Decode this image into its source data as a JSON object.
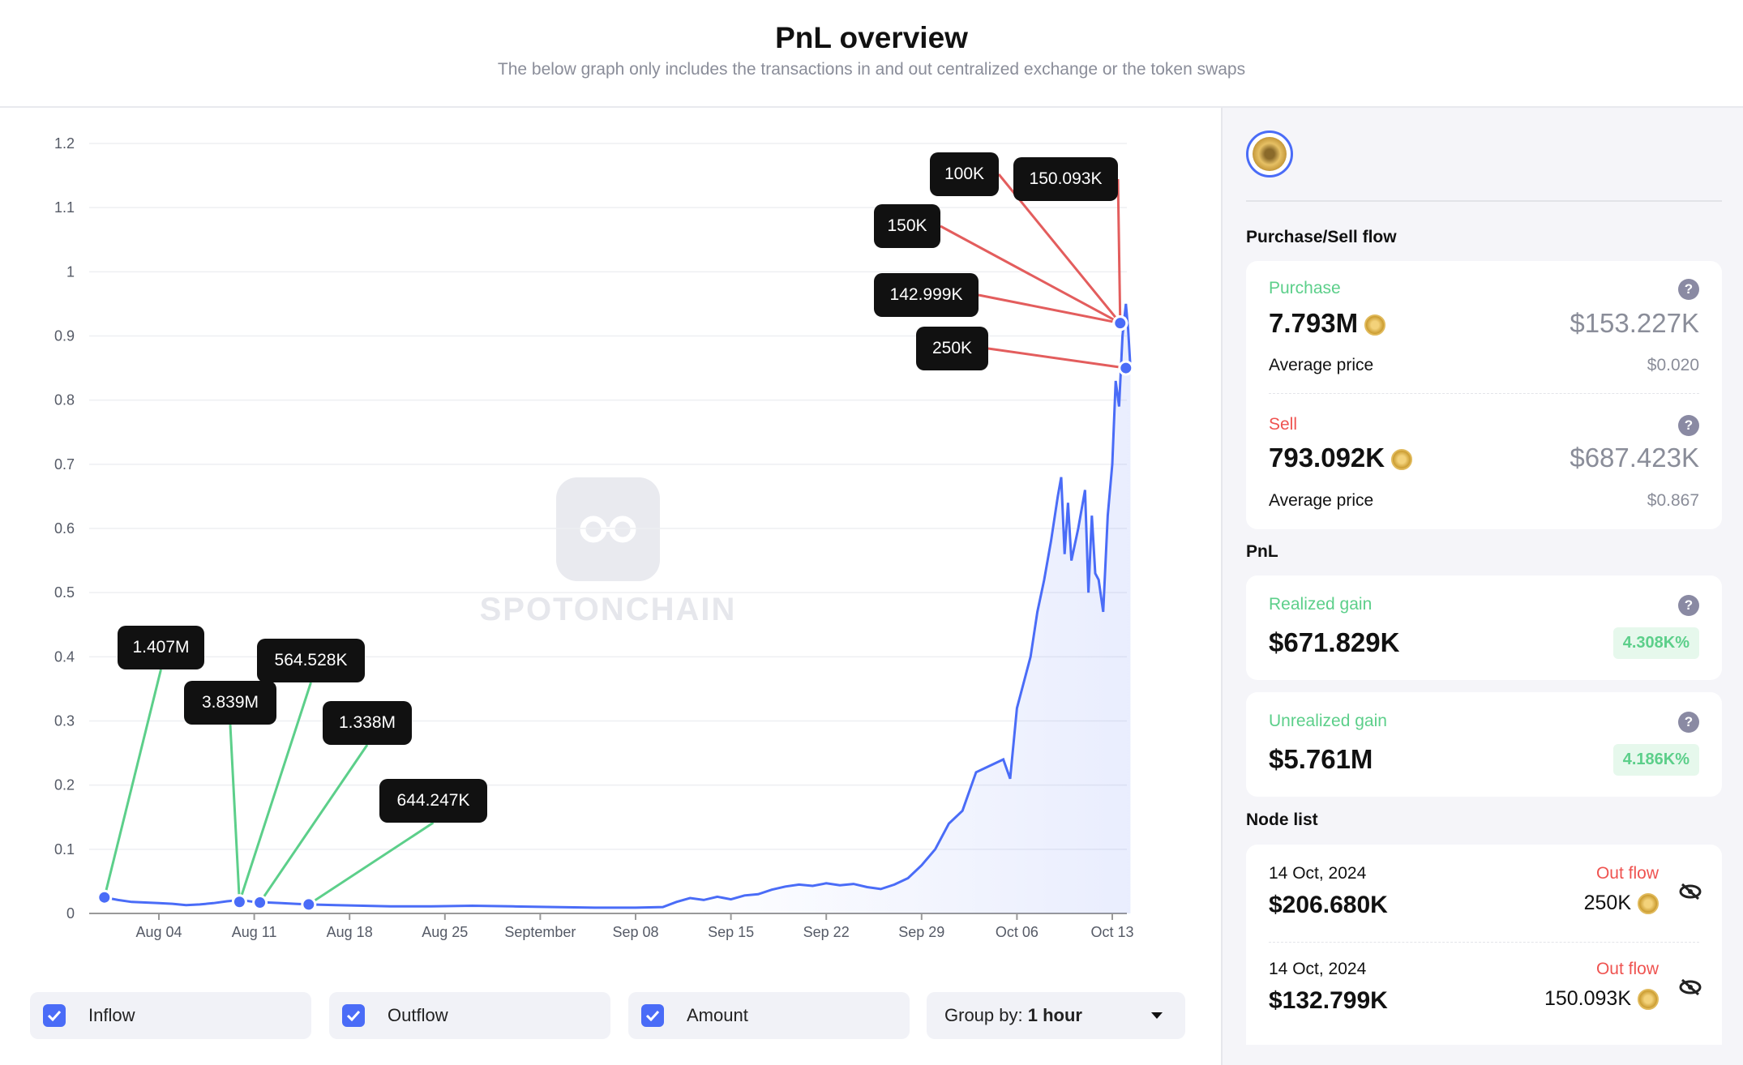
{
  "header": {
    "title": "PnL overview",
    "subtitle": "The below graph only includes the transactions in and out centralized exchange or the token swaps"
  },
  "chart_data": {
    "type": "line",
    "y_ticks": [
      "0",
      "0.1",
      "0.2",
      "0.3",
      "0.4",
      "0.5",
      "0.6",
      "0.7",
      "0.8",
      "0.9",
      "1",
      "1.1",
      "1.2"
    ],
    "ylim": [
      0,
      1.2
    ],
    "x_ticks": [
      {
        "label": "Aug 04",
        "date": "2024-08-04"
      },
      {
        "label": "Aug 11",
        "date": "2024-08-11"
      },
      {
        "label": "Aug 18",
        "date": "2024-08-18"
      },
      {
        "label": "Aug 25",
        "date": "2024-08-25"
      },
      {
        "label": "September",
        "date": "2024-09-01"
      },
      {
        "label": "Sep 08",
        "date": "2024-09-08"
      },
      {
        "label": "Sep 15",
        "date": "2024-09-15"
      },
      {
        "label": "Sep 22",
        "date": "2024-09-22"
      },
      {
        "label": "Sep 29",
        "date": "2024-09-29"
      },
      {
        "label": "Oct 06",
        "date": "2024-10-06"
      },
      {
        "label": "Oct 13",
        "date": "2024-10-13"
      }
    ],
    "xlim": [
      "2024-07-30 21:00",
      "2024-10-14 08:00"
    ],
    "grid": true,
    "line_color": "#4a6cf7",
    "inflow_color": "#5ccf8a",
    "outflow_color": "#e35d5d",
    "series": [
      {
        "points": [
          [
            "2024-07-30 21:00",
            0.024
          ],
          [
            "2024-07-31 00:00",
            0.025
          ],
          [
            "2024-08-01 00:00",
            0.021
          ],
          [
            "2024-08-02 00:00",
            0.018
          ],
          [
            "2024-08-03 00:00",
            0.017
          ],
          [
            "2024-08-04 00:00",
            0.016
          ],
          [
            "2024-08-05 00:00",
            0.015
          ],
          [
            "2024-08-06 00:00",
            0.013
          ],
          [
            "2024-08-07 00:00",
            0.014
          ],
          [
            "2024-08-08 00:00",
            0.016
          ],
          [
            "2024-08-09 00:00",
            0.019
          ],
          [
            "2024-08-10 00:00",
            0.021
          ],
          [
            "2024-08-11 00:00",
            0.018
          ],
          [
            "2024-08-12 00:00",
            0.017
          ],
          [
            "2024-08-13 00:00",
            0.016
          ],
          [
            "2024-08-14 00:00",
            0.015
          ],
          [
            "2024-08-15 00:00",
            0.014
          ],
          [
            "2024-08-17 00:00",
            0.013
          ],
          [
            "2024-08-19 00:00",
            0.012
          ],
          [
            "2024-08-21 00:00",
            0.011
          ],
          [
            "2024-08-24 00:00",
            0.011
          ],
          [
            "2024-08-27 00:00",
            0.012
          ],
          [
            "2024-08-30 00:00",
            0.011
          ],
          [
            "2024-09-02 00:00",
            0.01
          ],
          [
            "2024-09-05 00:00",
            0.009
          ],
          [
            "2024-09-08 00:00",
            0.009
          ],
          [
            "2024-09-10 00:00",
            0.01
          ],
          [
            "2024-09-11 00:00",
            0.018
          ],
          [
            "2024-09-12 00:00",
            0.024
          ],
          [
            "2024-09-13 00:00",
            0.021
          ],
          [
            "2024-09-14 00:00",
            0.026
          ],
          [
            "2024-09-15 00:00",
            0.022
          ],
          [
            "2024-09-16 00:00",
            0.028
          ],
          [
            "2024-09-17 00:00",
            0.03
          ],
          [
            "2024-09-18 00:00",
            0.037
          ],
          [
            "2024-09-19 00:00",
            0.042
          ],
          [
            "2024-09-20 00:00",
            0.045
          ],
          [
            "2024-09-21 00:00",
            0.043
          ],
          [
            "2024-09-22 00:00",
            0.047
          ],
          [
            "2024-09-23 00:00",
            0.044
          ],
          [
            "2024-09-24 00:00",
            0.046
          ],
          [
            "2024-09-25 00:00",
            0.041
          ],
          [
            "2024-09-26 00:00",
            0.038
          ],
          [
            "2024-09-27 00:00",
            0.045
          ],
          [
            "2024-09-28 00:00",
            0.055
          ],
          [
            "2024-09-29 00:00",
            0.075
          ],
          [
            "2024-09-30 00:00",
            0.1
          ],
          [
            "2024-10-01 00:00",
            0.14
          ],
          [
            "2024-10-02 00:00",
            0.16
          ],
          [
            "2024-10-03 00:00",
            0.22
          ],
          [
            "2024-10-04 00:00",
            0.23
          ],
          [
            "2024-10-05 00:00",
            0.24
          ],
          [
            "2024-10-05 12:00",
            0.21
          ],
          [
            "2024-10-06 00:00",
            0.32
          ],
          [
            "2024-10-06 12:00",
            0.36
          ],
          [
            "2024-10-07 00:00",
            0.4
          ],
          [
            "2024-10-07 12:00",
            0.47
          ],
          [
            "2024-10-08 00:00",
            0.52
          ],
          [
            "2024-10-08 12:00",
            0.58
          ],
          [
            "2024-10-09 00:00",
            0.65
          ],
          [
            "2024-10-09 06:00",
            0.68
          ],
          [
            "2024-10-09 12:00",
            0.56
          ],
          [
            "2024-10-09 18:00",
            0.64
          ],
          [
            "2024-10-10 00:00",
            0.55
          ],
          [
            "2024-10-10 12:00",
            0.6
          ],
          [
            "2024-10-11 00:00",
            0.66
          ],
          [
            "2024-10-11 06:00",
            0.5
          ],
          [
            "2024-10-11 12:00",
            0.62
          ],
          [
            "2024-10-11 18:00",
            0.53
          ],
          [
            "2024-10-12 00:00",
            0.52
          ],
          [
            "2024-10-12 08:00",
            0.47
          ],
          [
            "2024-10-12 16:00",
            0.62
          ],
          [
            "2024-10-13 00:00",
            0.7
          ],
          [
            "2024-10-13 06:00",
            0.83
          ],
          [
            "2024-10-13 12:00",
            0.79
          ],
          [
            "2024-10-13 18:00",
            0.9
          ],
          [
            "2024-10-14 00:00",
            0.95
          ],
          [
            "2024-10-14 04:00",
            0.91
          ],
          [
            "2024-10-14 08:00",
            0.85
          ]
        ]
      }
    ],
    "annotations": [
      {
        "flow": "inflow",
        "amount": "1.407M",
        "date": "2024-07-31 00:00",
        "price": 0.025
      },
      {
        "flow": "inflow",
        "amount": "3.839M",
        "date": "2024-08-09 22:00",
        "price": 0.018
      },
      {
        "flow": "inflow",
        "amount": "564.528K",
        "date": "2024-08-09 22:00",
        "price": 0.018
      },
      {
        "flow": "inflow",
        "amount": "1.338M",
        "date": "2024-08-11 10:00",
        "price": 0.017
      },
      {
        "flow": "inflow",
        "amount": "644.247K",
        "date": "2024-08-15 00:00",
        "price": 0.014
      },
      {
        "flow": "outflow",
        "amount": "100K",
        "date": "2024-10-13 14:00",
        "price": 0.92
      },
      {
        "flow": "outflow",
        "amount": "150.093K",
        "date": "2024-10-13 14:00",
        "price": 0.92
      },
      {
        "flow": "outflow",
        "amount": "150K",
        "date": "2024-10-13 14:00",
        "price": 0.92
      },
      {
        "flow": "outflow",
        "amount": "142.999K",
        "date": "2024-10-13 14:00",
        "price": 0.92
      },
      {
        "flow": "outflow",
        "amount": "250K",
        "date": "2024-10-14 00:00",
        "price": 0.85
      }
    ],
    "watermark": "SPOTONCHAIN"
  },
  "controls": {
    "inflow": {
      "label": "Inflow",
      "checked": true
    },
    "outflow": {
      "label": "Outflow",
      "checked": true
    },
    "amount": {
      "label": "Amount",
      "checked": true
    },
    "group_by": {
      "label": "Group by:",
      "value": "1 hour"
    }
  },
  "panel": {
    "flow_title": "Purchase/Sell flow",
    "purchase": {
      "label": "Purchase",
      "amount": "7.793M",
      "usd": "$153.227K",
      "avg_label": "Average price",
      "avg": "$0.020"
    },
    "sell": {
      "label": "Sell",
      "amount": "793.092K",
      "usd": "$687.423K",
      "avg_label": "Average price",
      "avg": "$0.867"
    },
    "pnl_title": "PnL",
    "realized": {
      "label": "Realized gain",
      "value": "$671.829K",
      "pct": "4.308K%"
    },
    "unrealized": {
      "label": "Unrealized gain",
      "value": "$5.761M",
      "pct": "4.186K%"
    },
    "node_title": "Node list",
    "nodes": [
      {
        "date": "14 Oct, 2024",
        "usd": "$206.680K",
        "flow": "Out flow",
        "amount": "250K"
      },
      {
        "date": "14 Oct, 2024",
        "usd": "$132.799K",
        "flow": "Out flow",
        "amount": "150.093K"
      }
    ]
  }
}
